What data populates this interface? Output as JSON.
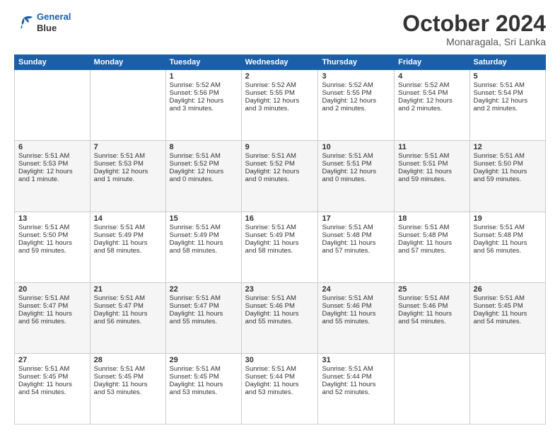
{
  "header": {
    "logo_line1": "General",
    "logo_line2": "Blue",
    "month": "October 2024",
    "location": "Monaragala, Sri Lanka"
  },
  "days_of_week": [
    "Sunday",
    "Monday",
    "Tuesday",
    "Wednesday",
    "Thursday",
    "Friday",
    "Saturday"
  ],
  "weeks": [
    [
      {
        "day": "",
        "info": ""
      },
      {
        "day": "",
        "info": ""
      },
      {
        "day": "1",
        "info": "Sunrise: 5:52 AM\nSunset: 5:56 PM\nDaylight: 12 hours\nand 3 minutes."
      },
      {
        "day": "2",
        "info": "Sunrise: 5:52 AM\nSunset: 5:55 PM\nDaylight: 12 hours\nand 3 minutes."
      },
      {
        "day": "3",
        "info": "Sunrise: 5:52 AM\nSunset: 5:55 PM\nDaylight: 12 hours\nand 2 minutes."
      },
      {
        "day": "4",
        "info": "Sunrise: 5:52 AM\nSunset: 5:54 PM\nDaylight: 12 hours\nand 2 minutes."
      },
      {
        "day": "5",
        "info": "Sunrise: 5:51 AM\nSunset: 5:54 PM\nDaylight: 12 hours\nand 2 minutes."
      }
    ],
    [
      {
        "day": "6",
        "info": "Sunrise: 5:51 AM\nSunset: 5:53 PM\nDaylight: 12 hours\nand 1 minute."
      },
      {
        "day": "7",
        "info": "Sunrise: 5:51 AM\nSunset: 5:53 PM\nDaylight: 12 hours\nand 1 minute."
      },
      {
        "day": "8",
        "info": "Sunrise: 5:51 AM\nSunset: 5:52 PM\nDaylight: 12 hours\nand 0 minutes."
      },
      {
        "day": "9",
        "info": "Sunrise: 5:51 AM\nSunset: 5:52 PM\nDaylight: 12 hours\nand 0 minutes."
      },
      {
        "day": "10",
        "info": "Sunrise: 5:51 AM\nSunset: 5:51 PM\nDaylight: 12 hours\nand 0 minutes."
      },
      {
        "day": "11",
        "info": "Sunrise: 5:51 AM\nSunset: 5:51 PM\nDaylight: 11 hours\nand 59 minutes."
      },
      {
        "day": "12",
        "info": "Sunrise: 5:51 AM\nSunset: 5:50 PM\nDaylight: 11 hours\nand 59 minutes."
      }
    ],
    [
      {
        "day": "13",
        "info": "Sunrise: 5:51 AM\nSunset: 5:50 PM\nDaylight: 11 hours\nand 59 minutes."
      },
      {
        "day": "14",
        "info": "Sunrise: 5:51 AM\nSunset: 5:49 PM\nDaylight: 11 hours\nand 58 minutes."
      },
      {
        "day": "15",
        "info": "Sunrise: 5:51 AM\nSunset: 5:49 PM\nDaylight: 11 hours\nand 58 minutes."
      },
      {
        "day": "16",
        "info": "Sunrise: 5:51 AM\nSunset: 5:49 PM\nDaylight: 11 hours\nand 58 minutes."
      },
      {
        "day": "17",
        "info": "Sunrise: 5:51 AM\nSunset: 5:48 PM\nDaylight: 11 hours\nand 57 minutes."
      },
      {
        "day": "18",
        "info": "Sunrise: 5:51 AM\nSunset: 5:48 PM\nDaylight: 11 hours\nand 57 minutes."
      },
      {
        "day": "19",
        "info": "Sunrise: 5:51 AM\nSunset: 5:48 PM\nDaylight: 11 hours\nand 56 minutes."
      }
    ],
    [
      {
        "day": "20",
        "info": "Sunrise: 5:51 AM\nSunset: 5:47 PM\nDaylight: 11 hours\nand 56 minutes."
      },
      {
        "day": "21",
        "info": "Sunrise: 5:51 AM\nSunset: 5:47 PM\nDaylight: 11 hours\nand 56 minutes."
      },
      {
        "day": "22",
        "info": "Sunrise: 5:51 AM\nSunset: 5:47 PM\nDaylight: 11 hours\nand 55 minutes."
      },
      {
        "day": "23",
        "info": "Sunrise: 5:51 AM\nSunset: 5:46 PM\nDaylight: 11 hours\nand 55 minutes."
      },
      {
        "day": "24",
        "info": "Sunrise: 5:51 AM\nSunset: 5:46 PM\nDaylight: 11 hours\nand 55 minutes."
      },
      {
        "day": "25",
        "info": "Sunrise: 5:51 AM\nSunset: 5:46 PM\nDaylight: 11 hours\nand 54 minutes."
      },
      {
        "day": "26",
        "info": "Sunrise: 5:51 AM\nSunset: 5:45 PM\nDaylight: 11 hours\nand 54 minutes."
      }
    ],
    [
      {
        "day": "27",
        "info": "Sunrise: 5:51 AM\nSunset: 5:45 PM\nDaylight: 11 hours\nand 54 minutes."
      },
      {
        "day": "28",
        "info": "Sunrise: 5:51 AM\nSunset: 5:45 PM\nDaylight: 11 hours\nand 53 minutes."
      },
      {
        "day": "29",
        "info": "Sunrise: 5:51 AM\nSunset: 5:45 PM\nDaylight: 11 hours\nand 53 minutes."
      },
      {
        "day": "30",
        "info": "Sunrise: 5:51 AM\nSunset: 5:44 PM\nDaylight: 11 hours\nand 53 minutes."
      },
      {
        "day": "31",
        "info": "Sunrise: 5:51 AM\nSunset: 5:44 PM\nDaylight: 11 hours\nand 52 minutes."
      },
      {
        "day": "",
        "info": ""
      },
      {
        "day": "",
        "info": ""
      }
    ]
  ]
}
